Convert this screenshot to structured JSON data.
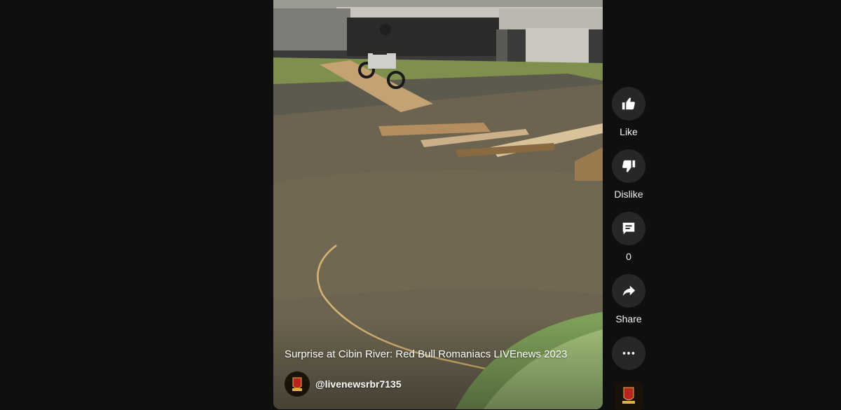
{
  "video": {
    "title": "Surprise at Cibin River: Red Bull Romaniacs LIVEnews 2023",
    "channel_handle": "@livenewsrbr7135",
    "channel_avatar_icon": "channel-logo-icon"
  },
  "actions": {
    "like": {
      "label": "Like",
      "icon": "thumbs-up-icon"
    },
    "dislike": {
      "label": "Dislike",
      "icon": "thumbs-down-icon"
    },
    "comments": {
      "count": "0",
      "icon": "comment-icon"
    },
    "share": {
      "label": "Share",
      "icon": "share-icon"
    },
    "more": {
      "icon": "more-horizontal-icon"
    }
  },
  "colors": {
    "page_background": "#0f0f0f",
    "action_button": "#272727",
    "text": "#f1f1f1"
  }
}
